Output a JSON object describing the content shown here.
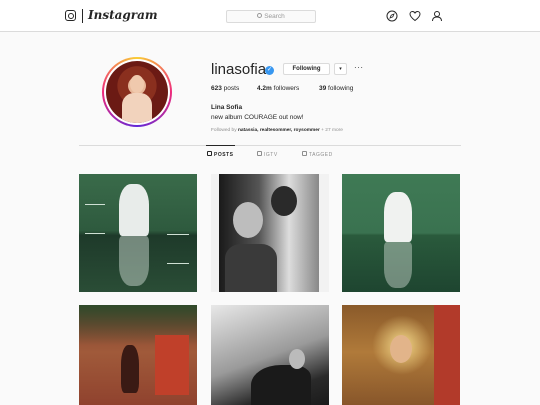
{
  "nav": {
    "brand": "Instagram",
    "search_placeholder": "Search",
    "icons": [
      "instagram-glyph-icon",
      "compass-icon",
      "heart-icon",
      "user-icon"
    ]
  },
  "profile": {
    "username": "linasofia",
    "verified": true,
    "follow_label": "Following",
    "dropdown_glyph": "▾",
    "more_glyph": "···",
    "stats": {
      "posts_num": "623",
      "posts_label": "posts",
      "followers_num": "4.2m",
      "followers_label": "followers",
      "following_num": "39",
      "following_label": "following"
    },
    "full_name": "Lina Sofia",
    "bio": "new album COURAGE out now!",
    "followed_by_prefix": "Followed by",
    "followed_by_names": "natassia, realtesommer, roysommer",
    "followed_by_suffix": "+ 27 more"
  },
  "tabs": [
    {
      "label": "POSTS",
      "active": true
    },
    {
      "label": "IGTV",
      "active": false
    },
    {
      "label": "TAGGED",
      "active": false
    }
  ],
  "colors": {
    "verified_blue": "#3897f0",
    "border": "#dbdbdb",
    "muted_text": "#8e8e8e"
  }
}
